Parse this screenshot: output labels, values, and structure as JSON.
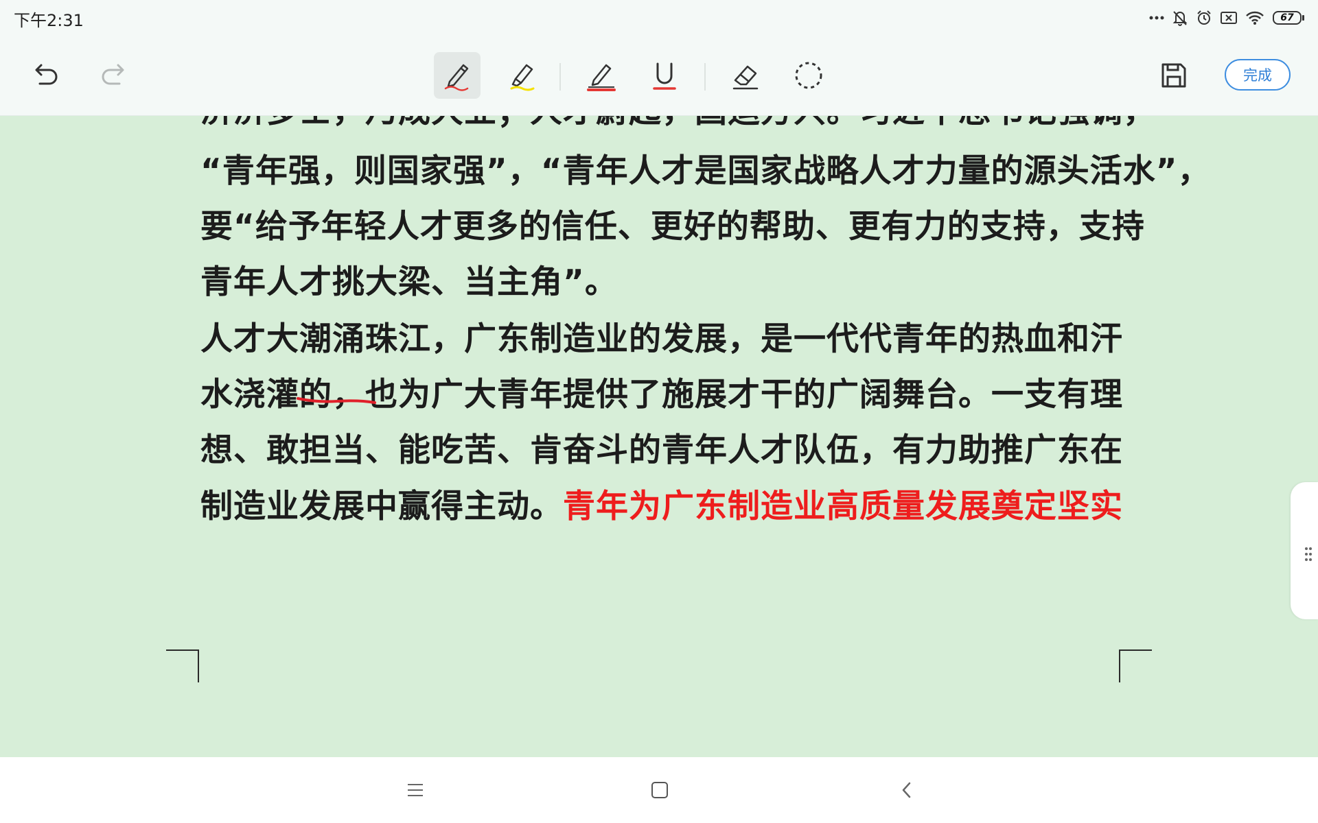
{
  "status_bar": {
    "time": "下午2:31",
    "battery_level": "67",
    "icons": [
      "more-dots-icon",
      "mute-bell-icon",
      "alarm-icon",
      "sim-off-icon",
      "wifi-icon",
      "battery-icon"
    ]
  },
  "toolbar": {
    "tools": [
      {
        "name": "pen-tool",
        "icon": "pen-icon",
        "active": true,
        "accent": "#e53935"
      },
      {
        "name": "highlighter-tool",
        "icon": "highlighter-icon",
        "active": false,
        "accent": "#f5e100"
      },
      {
        "name": "strike-pen-tool",
        "icon": "strike-pen-icon",
        "active": false,
        "accent": "#e53935"
      },
      {
        "name": "underline-tool",
        "icon": "underline-icon",
        "active": false,
        "accent": "#e53935"
      },
      {
        "name": "eraser-tool",
        "icon": "eraser-icon",
        "active": false
      },
      {
        "name": "lasso-tool",
        "icon": "lasso-select-icon",
        "active": false
      }
    ],
    "done_label": "完成"
  },
  "document": {
    "lines": [
      {
        "text": "“青年强，则国家强”，“青年人才是国家战略人才力量的源头活水”，"
      },
      {
        "text": "要“给予年轻人才更多的信任、更好的帮助、更有力的支持，支持"
      },
      {
        "text": "青年人才挑大梁、当主角”。"
      },
      {
        "text": "人才大潮涌珠江，广东制造业的发展，是一代代青年的热血和汗"
      },
      {
        "text": "水浇灌的，也为广大青年提供了施展才干的广阔舞台。一支有理"
      },
      {
        "text": "想、敢担当、能吃苦、肯奋斗的青年人才队伍，有力助推广东在"
      },
      {
        "text": "制造业发展中赢得主动。",
        "red_text": "青年为广东制造业高质量发展奠定坚实"
      }
    ],
    "colors": {
      "background": "#d7eed8",
      "text": "#1c1c1c",
      "highlight_red": "#ee1d1d",
      "ink": "#e0202a"
    }
  },
  "nav_bar": {
    "buttons": [
      "menu-icon",
      "home-icon",
      "back-icon"
    ]
  }
}
